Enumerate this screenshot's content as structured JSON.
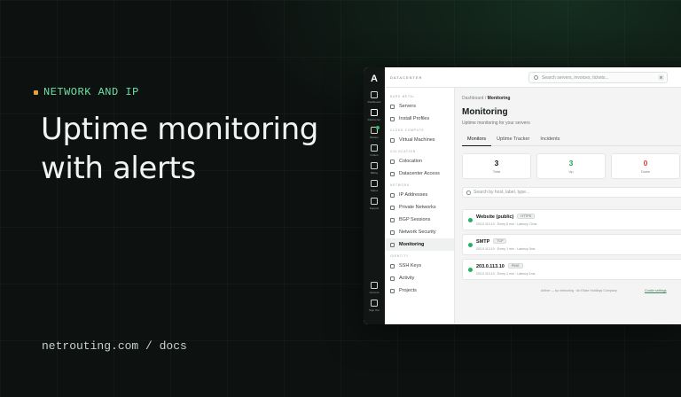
{
  "hero": {
    "eyebrow": "NETWORK AND IP",
    "headline": "Uptime monitoring with alerts",
    "footer_link": "netrouting.com / docs"
  },
  "app": {
    "rail": {
      "logo": "A",
      "items": [
        {
          "label": "Dashboard",
          "icon": "grid-icon"
        },
        {
          "label": "Datacenter",
          "icon": "server-icon"
        },
        {
          "label": "Basket",
          "icon": "cart-icon"
        },
        {
          "label": "Orders",
          "icon": "box-icon"
        },
        {
          "label": "Billing",
          "icon": "file-icon"
        },
        {
          "label": "Status",
          "icon": "pulse-icon"
        },
        {
          "label": "Support",
          "icon": "gear-icon"
        }
      ],
      "bottom": [
        {
          "label": "Account",
          "icon": "user-icon"
        },
        {
          "label": "Sign Out",
          "icon": "signout-icon"
        }
      ]
    },
    "topbar": {
      "workspace": "DATACENTER",
      "search_placeholder": "Search servers, invoices, tickets...",
      "search_kbd": "⌘"
    },
    "nav": {
      "groups": [
        {
          "label": "BARE METAL",
          "items": [
            "Servers",
            "Install Profiles"
          ]
        },
        {
          "label": "CLOUD COMPUTE",
          "items": [
            "Virtual Machines"
          ]
        },
        {
          "label": "COLOCATION",
          "items": [
            "Colocation",
            "Datacenter Access"
          ]
        },
        {
          "label": "NETWORK",
          "items": [
            "IP Addresses",
            "Private Networks",
            "BGP Sessions",
            "Network Security",
            "Monitoring"
          ]
        },
        {
          "label": "IDENTITY",
          "items": [
            "SSH Keys",
            "Activity",
            "Projects"
          ]
        }
      ],
      "active": "Monitoring"
    },
    "main": {
      "breadcrumb_root": "Dashboard",
      "breadcrumb_sep": "/",
      "breadcrumb_current": "Monitoring",
      "title": "Monitoring",
      "subtitle": "Uptime monitoring for your servers",
      "tabs": [
        "Monitors",
        "Uptime Tracker",
        "Incidents"
      ],
      "stats": [
        {
          "value": "3",
          "label": "Total"
        },
        {
          "value": "3",
          "label": "Up"
        },
        {
          "value": "0",
          "label": "Down"
        }
      ],
      "filter_placeholder": "Search by host, label, type...",
      "monitors": [
        {
          "name": "Website (public)",
          "type": "HTTPS",
          "meta": "203.0.113.10 · Every 5 min · Latency 72ms"
        },
        {
          "name": "SMTP",
          "type": "TCP",
          "meta": "203.0.113.10 · Every 1 min · Latency 3ms"
        },
        {
          "name": "203.0.113.10",
          "type": "PING",
          "meta": "203.0.113.10 · Every 1 min · Latency 1ms"
        }
      ],
      "footer_left": "Aether — by netrouting · An Eliate Holdings Company",
      "footer_right": "Cookie settings"
    },
    "colors": {
      "accent": "#6fe0a6",
      "up": "#21a15a",
      "down": "#d94141",
      "eyebrow_dot": "#e8a23a"
    }
  }
}
